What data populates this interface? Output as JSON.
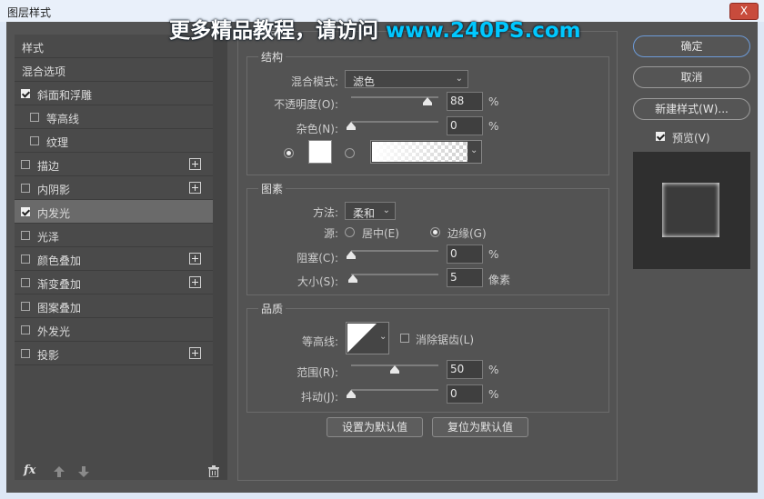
{
  "window": {
    "title": "图层样式",
    "close_glyph": "X"
  },
  "watermark": {
    "text": "更多精品教程，请访问 ",
    "url": "www.240PS.com"
  },
  "left_panel": {
    "items": [
      {
        "label": "样式",
        "checkbox": false,
        "checked": false,
        "plus": false,
        "active": false
      },
      {
        "label": "混合选项",
        "checkbox": false,
        "checked": false,
        "plus": false,
        "active": false
      },
      {
        "label": "斜面和浮雕",
        "checkbox": true,
        "checked": true,
        "plus": false,
        "active": false
      },
      {
        "label": "等高线",
        "checkbox": true,
        "checked": false,
        "plus": false,
        "active": false,
        "indent": true
      },
      {
        "label": "纹理",
        "checkbox": true,
        "checked": false,
        "plus": false,
        "active": false,
        "indent": true
      },
      {
        "label": "描边",
        "checkbox": true,
        "checked": false,
        "plus": true,
        "active": false
      },
      {
        "label": "内阴影",
        "checkbox": true,
        "checked": false,
        "plus": true,
        "active": false
      },
      {
        "label": "内发光",
        "checkbox": true,
        "checked": true,
        "plus": false,
        "active": true
      },
      {
        "label": "光泽",
        "checkbox": true,
        "checked": false,
        "plus": false,
        "active": false
      },
      {
        "label": "颜色叠加",
        "checkbox": true,
        "checked": false,
        "plus": true,
        "active": false
      },
      {
        "label": "渐变叠加",
        "checkbox": true,
        "checked": false,
        "plus": true,
        "active": false
      },
      {
        "label": "图案叠加",
        "checkbox": true,
        "checked": false,
        "plus": false,
        "active": false
      },
      {
        "label": "外发光",
        "checkbox": true,
        "checked": false,
        "plus": false,
        "active": false
      },
      {
        "label": "投影",
        "checkbox": true,
        "checked": false,
        "plus": true,
        "active": false
      }
    ],
    "fx_label": "fx"
  },
  "panel_title": "内发光",
  "structure": {
    "title": "结构",
    "blend_mode_label": "混合模式:",
    "blend_mode_value": "滤色",
    "opacity_label": "不透明度(O):",
    "opacity_value": "88",
    "opacity_percent": 88,
    "noise_label": "杂色(N):",
    "noise_value": "0",
    "noise_percent": 0,
    "percent_unit": "%"
  },
  "elements": {
    "title": "图素",
    "method_label": "方法:",
    "method_value": "柔和",
    "source_label": "源:",
    "source_center": "居中(E)",
    "source_edge": "边缘(G)",
    "choke_label": "阻塞(C):",
    "choke_value": "0",
    "choke_percent": 0,
    "size_label": "大小(S):",
    "size_value": "5",
    "size_fraction": 0.02,
    "size_unit": "像素",
    "percent_unit": "%"
  },
  "quality": {
    "title": "品质",
    "contour_label": "等高线:",
    "antialias_label": "消除锯齿(L)",
    "range_label": "范围(R):",
    "range_value": "50",
    "range_percent": 50,
    "jitter_label": "抖动(J):",
    "jitter_value": "0",
    "jitter_percent": 0,
    "percent_unit": "%"
  },
  "bottom_buttons": {
    "set_default": "设置为默认值",
    "reset_default": "复位为默认值"
  },
  "right_panel": {
    "ok": "确定",
    "cancel": "取消",
    "new_style": "新建样式(W)...",
    "preview_label": "预览(V)",
    "preview_checked": true
  },
  "colors": {
    "panel_bg": "#535353",
    "list_bg": "#4a4a4a",
    "active_row": "#6a6a6a",
    "accent_border": "#6d9bd8",
    "watermark_url": "#00c8ff"
  }
}
